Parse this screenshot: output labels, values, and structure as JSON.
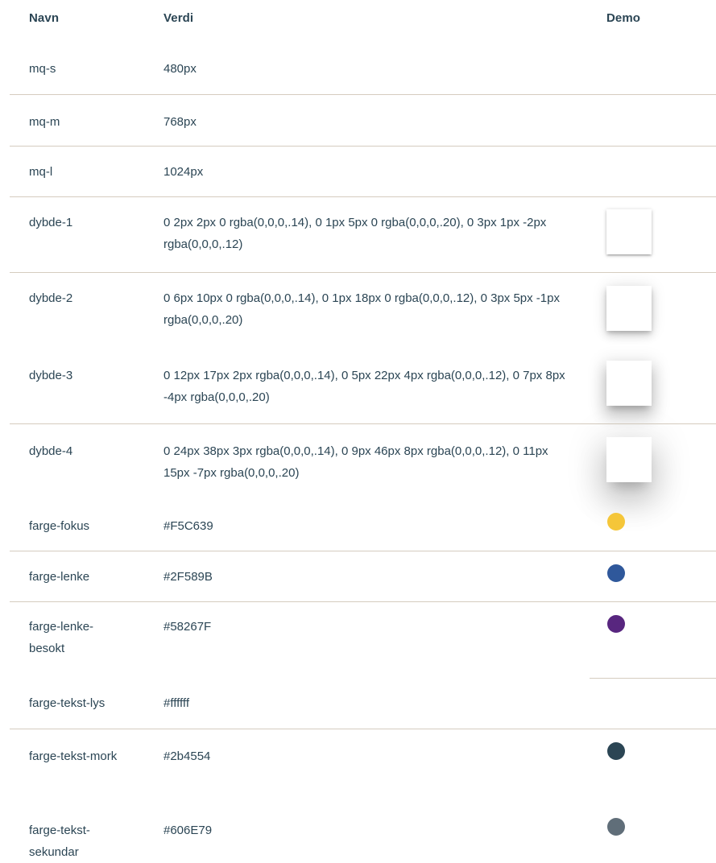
{
  "header": {
    "name": "Navn",
    "value": "Verdi",
    "demo": "Demo"
  },
  "rows": [
    {
      "name": "mq-s",
      "value": "480px"
    },
    {
      "name": "mq-m",
      "value": "768px"
    },
    {
      "name": "mq-l",
      "value": "1024px"
    },
    {
      "name": "dybde-1",
      "value": "0 2px 2px 0 rgba(0,0,0,.14), 0 1px 5px 0 rgba(0,0,0,.20), 0 3px 1px -2px rgba(0,0,0,.12)"
    },
    {
      "name": "dybde-2",
      "value": "0 6px 10px 0 rgba(0,0,0,.14), 0 1px 18px 0 rgba(0,0,0,.12), 0 3px 5px -1px rgba(0,0,0,.20)"
    },
    {
      "name": "dybde-3",
      "value": "0 12px 17px 2px rgba(0,0,0,.14), 0 5px 22px 4px rgba(0,0,0,.12), 0 7px 8px -4px rgba(0,0,0,.20)"
    },
    {
      "name": "dybde-4",
      "value": "0 24px 38px 3px rgba(0,0,0,.14), 0 9px 46px 8px rgba(0,0,0,.12), 0 11px 15px -7px rgba(0,0,0,.20)"
    },
    {
      "name": "farge-fokus",
      "value": "#F5C639",
      "color": "#F5C639"
    },
    {
      "name": "farge-lenke",
      "value": "#2F589B",
      "color": "#2F589B"
    },
    {
      "name": "farge-lenke-besokt",
      "value": "#58267F",
      "color": "#58267F"
    },
    {
      "name": "farge-tekst-lys",
      "value": "#ffffff",
      "color": "#ffffff"
    },
    {
      "name": "farge-tekst-mork",
      "value": "#2b4554",
      "color": "#2b4554"
    },
    {
      "name": "farge-tekst-sekundar",
      "value": "#606E79",
      "color": "#606E79"
    }
  ]
}
